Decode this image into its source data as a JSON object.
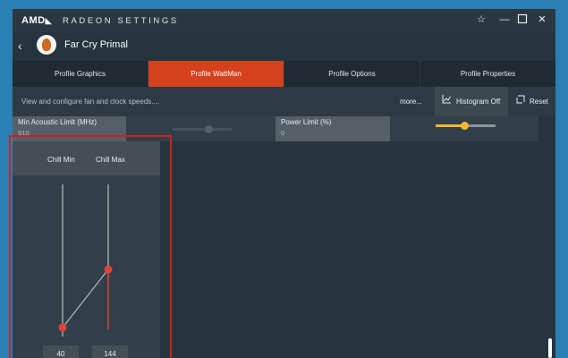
{
  "app": {
    "logo_text": "AMD",
    "title": "RADEON SETTINGS"
  },
  "window_controls": {
    "favorite_icon": "star-icon",
    "minimize_icon": "minimize-icon",
    "maximize_icon": "maximize-icon",
    "close_icon": "close-icon"
  },
  "game": {
    "name": "Far Cry Primal"
  },
  "tabs": [
    {
      "label": "Profile Graphics",
      "active": false
    },
    {
      "label": "Profile WattMan",
      "active": true
    },
    {
      "label": "Profile Options",
      "active": false
    },
    {
      "label": "Profile Properties",
      "active": false
    }
  ],
  "toolbar": {
    "description": "View and configure fan and clock speeds....",
    "more_label": "more...",
    "histogram_label": "Histogram Off",
    "reset_label": "Reset"
  },
  "params": {
    "min_acoustic": {
      "label": "Min Acoustic Limit (MHz)",
      "value": "910"
    },
    "power_limit": {
      "label": "Power Limit (%)",
      "value": "0"
    }
  },
  "chill": {
    "min_label": "Chill Min",
    "max_label": "Chill Max",
    "min_value": "40",
    "max_value": "144"
  },
  "colors": {
    "accent": "#d4411c",
    "slider_active": "#f5b82e",
    "chill_marker": "#e0443a",
    "highlight_border": "#cf2020"
  }
}
